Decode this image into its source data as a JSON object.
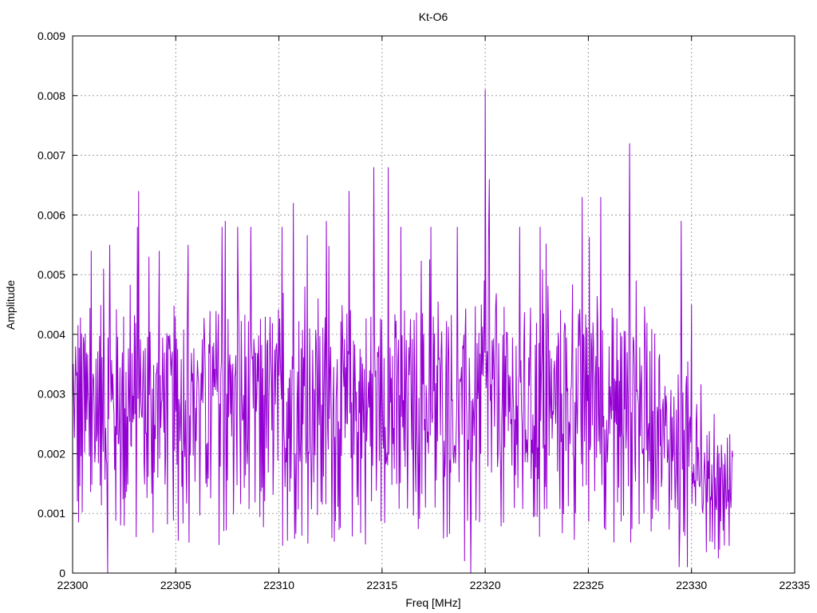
{
  "chart_data": {
    "type": "line",
    "title": "Kt-O6",
    "xlabel": "Freq [MHz]",
    "ylabel": "Amplitude",
    "xlim": [
      22300,
      22335
    ],
    "ylim": [
      0,
      0.009
    ],
    "x_ticks": [
      "22300",
      "22305",
      "22310",
      "22315",
      "22320",
      "22325",
      "22330",
      "22335"
    ],
    "y_ticks": [
      "0",
      "0.001",
      "0.002",
      "0.003",
      "0.004",
      "0.005",
      "0.006",
      "0.007",
      "0.008",
      "0.009"
    ],
    "x_tick_values": [
      22300,
      22305,
      22310,
      22315,
      22320,
      22325,
      22330,
      22335
    ],
    "y_tick_values": [
      0,
      0.001,
      0.002,
      0.003,
      0.004,
      0.005,
      0.006,
      0.007,
      0.008,
      0.009
    ],
    "grid": true,
    "series": [
      {
        "color": "#9400d3",
        "x_start": 22300,
        "x_end": 22332,
        "peaks": [
          {
            "x": 22301.5,
            "y": 0.0051
          },
          {
            "x": 22301.8,
            "y": 0.0055
          },
          {
            "x": 22303.2,
            "y": 0.0064
          },
          {
            "x": 22303.7,
            "y": 0.0053
          },
          {
            "x": 22304.2,
            "y": 0.0054
          },
          {
            "x": 22305.6,
            "y": 0.0055
          },
          {
            "x": 22307.4,
            "y": 0.0059
          },
          {
            "x": 22308.0,
            "y": 0.0058
          },
          {
            "x": 22310.7,
            "y": 0.0062
          },
          {
            "x": 22312.3,
            "y": 0.0059
          },
          {
            "x": 22313.4,
            "y": 0.0064
          },
          {
            "x": 22314.6,
            "y": 0.0068
          },
          {
            "x": 22315.3,
            "y": 0.0068
          },
          {
            "x": 22320.0,
            "y": 0.0081
          },
          {
            "x": 22320.2,
            "y": 0.0066
          },
          {
            "x": 22324.7,
            "y": 0.0063
          },
          {
            "x": 22325.6,
            "y": 0.0063
          },
          {
            "x": 22327.0,
            "y": 0.0072
          },
          {
            "x": 22329.5,
            "y": 0.0059
          },
          {
            "x": 22330.0,
            "y": 0.0045
          }
        ],
        "dips": [
          {
            "x": 22301.7,
            "y": 0.0
          },
          {
            "x": 22319.0,
            "y": 0.0002
          },
          {
            "x": 22319.3,
            "y": 0.0
          },
          {
            "x": 22329.4,
            "y": 0.0001
          },
          {
            "x": 22329.8,
            "y": 0.0001
          }
        ]
      }
    ]
  }
}
